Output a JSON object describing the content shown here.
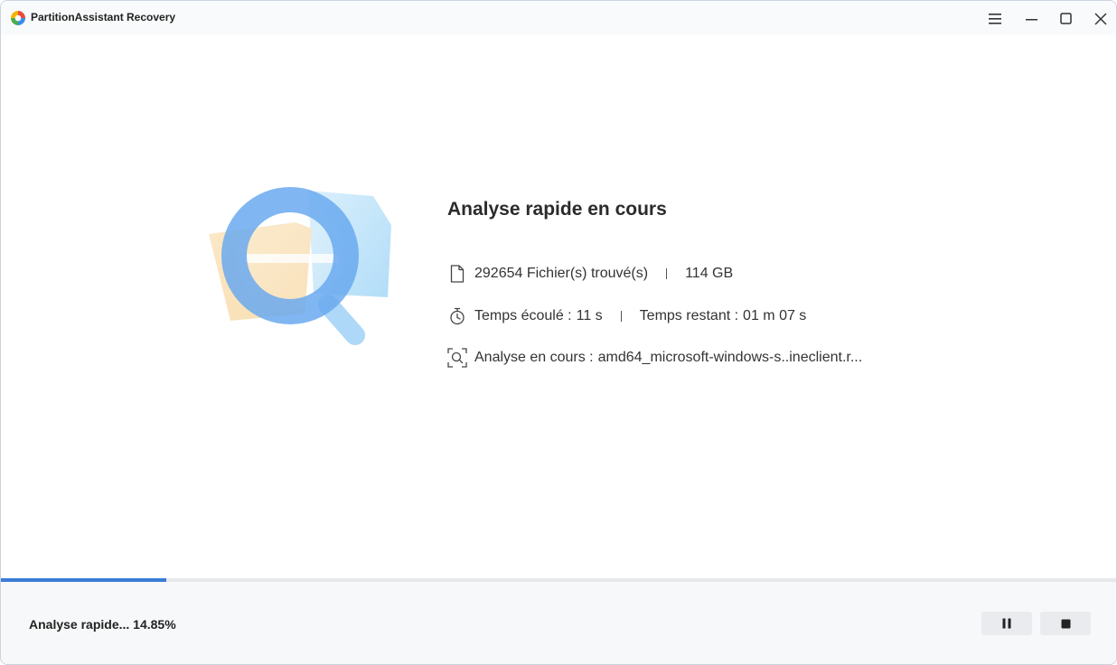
{
  "window": {
    "title": "PartitionAssistant Recovery",
    "controls": {
      "menu_icon": "hamburger-icon",
      "minimize_icon": "minimize-icon",
      "maximize_icon": "maximize-icon",
      "close_icon": "close-icon"
    }
  },
  "scan": {
    "title": "Analyse rapide en cours",
    "files_found": "292654 Fichier(s) trouvé(s)",
    "size_found": "114 GB",
    "elapsed_label": "Temps écoulé :",
    "elapsed_value": "11 s",
    "remaining_label": "Temps restant :",
    "remaining_value": "01 m 07 s",
    "current_label": "Analyse en cours :",
    "current_value": "amd64_microsoft-windows-s..ineclient.r..."
  },
  "progress": {
    "percent": 14.85,
    "status_text": "Analyse rapide... 14.85%"
  },
  "colors": {
    "accent": "#3a7bd5",
    "track": "#e6e8eb"
  },
  "footer": {
    "pause_icon": "pause-icon",
    "stop_icon": "stop-icon"
  }
}
